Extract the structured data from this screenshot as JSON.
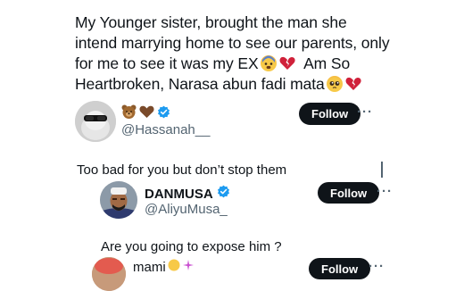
{
  "post": {
    "line1": "My Younger sister, brought the man she",
    "line2": "intend marrying home to see our parents, only",
    "line3a": "for me to see it was my EX",
    "line3b": "Am So",
    "line4": "Heartbroken, Narasa abun fadi mata",
    "author_handle": "@Hassanah__",
    "follow_label": "Follow",
    "more_label": "···"
  },
  "reply1": {
    "text": "Too bad for you but don’t stop them",
    "name": "DANMUSA",
    "handle": "@AliyuMusa_",
    "follow_label": "Follow",
    "more_label": "···"
  },
  "reply2": {
    "text": "Are you going to expose him ?",
    "name": "mami",
    "follow_label": "Follow",
    "more_label": "···"
  },
  "colors": {
    "text": "#0f1419",
    "secondary": "#536471",
    "verified": "#1d9bf0",
    "heart": "#d0213a",
    "button": "#0f1419"
  },
  "icons": [
    "fearful-face-emoji",
    "broken-heart-emoji",
    "pleading-face-emoji",
    "bear-emoji",
    "brown-heart-emoji",
    "verified-badge-icon"
  ]
}
